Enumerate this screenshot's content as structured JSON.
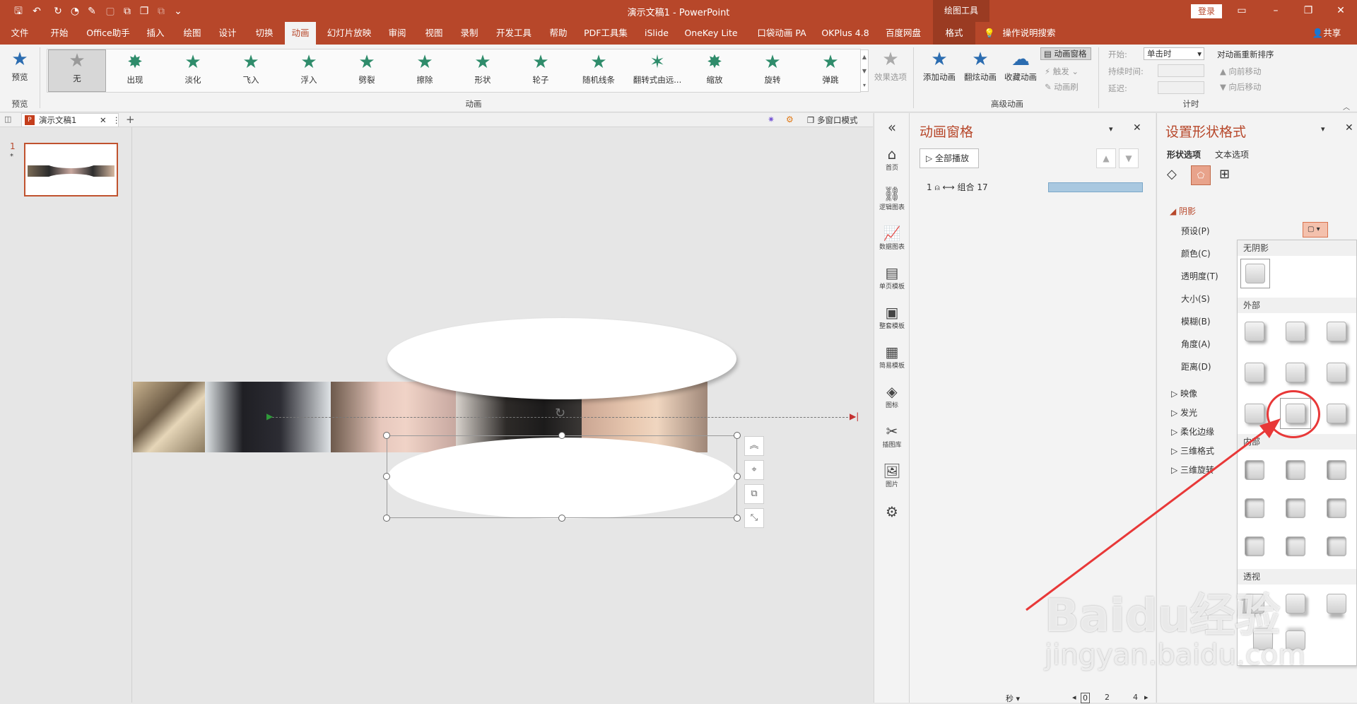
{
  "title_bar": {
    "doc_title": "演示文稿1  -  PowerPoint",
    "tool_context": "绘图工具",
    "login": "登录"
  },
  "tabs": [
    "文件",
    "开始",
    "Office助手",
    "插入",
    "绘图",
    "设计",
    "切换",
    "动画",
    "幻灯片放映",
    "审阅",
    "视图",
    "录制",
    "开发工具",
    "帮助",
    "PDF工具集",
    "iSlide",
    "OneKey Lite",
    "口袋动画 PA",
    "OKPlus 4.8",
    "百度网盘",
    "格式"
  ],
  "tell_me": "操作说明搜索",
  "share": "共享",
  "ribbon": {
    "preview_label": "预览",
    "preview_group": "预览",
    "effects": [
      "无",
      "出现",
      "淡化",
      "飞入",
      "浮入",
      "劈裂",
      "擦除",
      "形状",
      "轮子",
      "随机线条",
      "翻转式由远...",
      "缩放",
      "旋转",
      "弹跳"
    ],
    "effect_options": "效果选项",
    "animation_group": "动画",
    "add_animation": "添加动画",
    "painter": "动画刷 ",
    "animation_pane": "动画窗格",
    "trigger": "触发",
    "anim_brush": "动画刷",
    "advanced_group": "高级动画",
    "start_label": "开始:",
    "start_value": "单击时",
    "duration_label": "持续时间:",
    "delay_label": "延迟:",
    "timing_group": "计时",
    "reorder": "对动画重新排序",
    "move_earlier": "向前移动",
    "move_later": "向后移动",
    "anim_brush_label": "翻炫动画",
    "fav_anim": "收藏动画"
  },
  "doc_tab": {
    "name": "演示文稿1",
    "multi_window": "多窗口模式"
  },
  "slide_number": "1",
  "side_tools": [
    "首页",
    "逻辑图表",
    "数据图表",
    "单页模板",
    "整套模板",
    "简易模板",
    "图标",
    "插图库",
    "图片"
  ],
  "anim_pane": {
    "title": "动画窗格",
    "play_all": "全部播放",
    "item_index": "1",
    "item_name": "组合 17",
    "seconds": "秒",
    "ruler": [
      "0",
      "2",
      "4"
    ]
  },
  "format_pane": {
    "title": "设置形状格式",
    "tab_shape": "形状选项",
    "tab_text": "文本选项",
    "shadow_section": "阴影",
    "props": [
      "预设(P)",
      "颜色(C)",
      "透明度(T)",
      "大小(S)",
      "模糊(B)",
      "角度(A)",
      "距离(D)"
    ],
    "sections": [
      "映像",
      "发光",
      "柔化边缘",
      "三维格式",
      "三维旋转"
    ]
  },
  "shadow_gallery": {
    "no_shadow": "无阴影",
    "outer": "外部",
    "inner": "内部",
    "perspective": "透视"
  },
  "watermark": {
    "brand": "Baidu经验",
    "url": "jingyan.baidu.com"
  }
}
